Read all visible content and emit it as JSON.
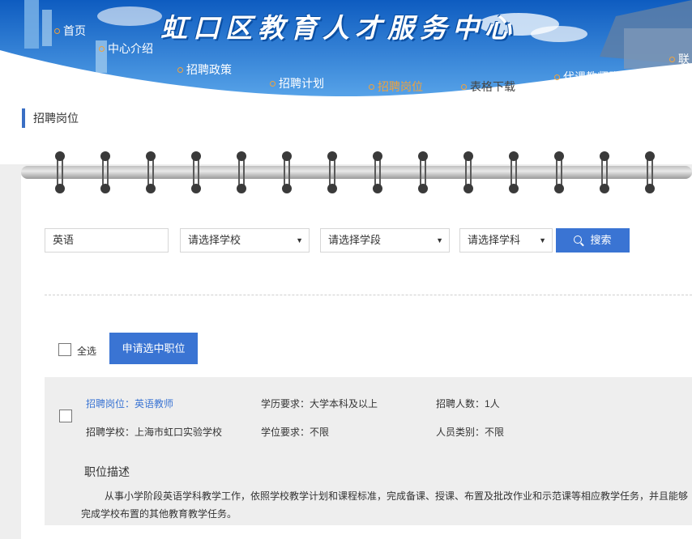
{
  "site": {
    "title": "虹口区教育人才服务中心"
  },
  "nav": [
    {
      "label": "首页"
    },
    {
      "label": "中心介绍"
    },
    {
      "label": "招聘政策"
    },
    {
      "label": "招聘计划"
    },
    {
      "label": "招聘岗位"
    },
    {
      "label": "表格下载"
    },
    {
      "label": "代课教师登记"
    },
    {
      "label": "联"
    }
  ],
  "page": {
    "title": "招聘岗位"
  },
  "search": {
    "keyword_value": "英语",
    "school_select": "请选择学校",
    "stage_select": "请选择学段",
    "subject_select": "请选择学科",
    "button_label": "搜索"
  },
  "actions": {
    "select_all_label": "全选",
    "apply_label": "申请选中职位"
  },
  "job": {
    "position": "招聘岗位：英语教师",
    "school": "招聘学校：上海市虹口实验学校",
    "education": "学历要求：大学本科及以上",
    "degree": "学位要求：不限",
    "headcount": "招聘人数：1人",
    "category": "人员类别：不限",
    "desc_title": "职位描述",
    "desc_line1": "从事小学阶段英语学科教学工作，依照学校教学计划和课程标准，完成备课、授课、布置及批改作业和示范课等相应教学任务，并且能够",
    "desc_line2": "完成学校布置的其他教育教学任务。"
  },
  "colors": {
    "accent": "#3a74d3",
    "nav_active": "#f2a23a",
    "banner_sky": "#1f76d6"
  }
}
